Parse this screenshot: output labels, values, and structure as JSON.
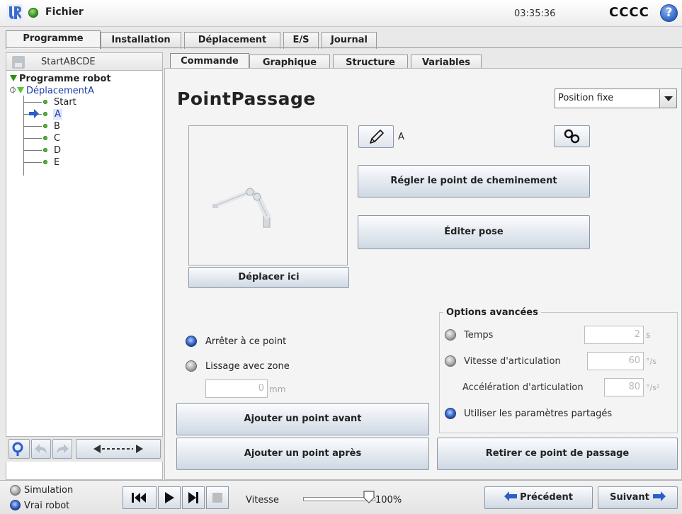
{
  "topbar": {
    "file_label": "Fichier",
    "clock": "03:35:36",
    "robot_name": "CCCC",
    "help_label": "?"
  },
  "main_tabs": [
    {
      "label": "Programme",
      "active": true
    },
    {
      "label": "Installation",
      "active": false
    },
    {
      "label": "Déplacement",
      "active": false
    },
    {
      "label": "E/S",
      "active": false
    },
    {
      "label": "Journal",
      "active": false
    }
  ],
  "left_panel": {
    "program_name": "StartABCDE",
    "tree": {
      "root": "Programme robot",
      "move": "DéplacementA",
      "waypoints": [
        "Start",
        "A",
        "B",
        "C",
        "D",
        "E"
      ],
      "selected": "A"
    }
  },
  "sub_tabs": [
    {
      "label": "Commande",
      "active": true
    },
    {
      "label": "Graphique",
      "active": false
    },
    {
      "label": "Structure",
      "active": false
    },
    {
      "label": "Variables",
      "active": false
    }
  ],
  "waypoint": {
    "title": "PointPassage",
    "type_dropdown": "Position fixe",
    "name": "A",
    "set_waypoint_button": "Régler le point de cheminement",
    "edit_pose_button": "Éditer pose",
    "move_here_button": "Déplacer ici",
    "stop_at_point": "Arrêter à ce point",
    "blend_with_radius": "Lissage avec zone",
    "blend_value": "0",
    "blend_unit": "mm",
    "add_before_button": "Ajouter un point avant",
    "add_after_button": "Ajouter un point après",
    "remove_button": "Retirer ce point de passage"
  },
  "advanced": {
    "title": "Options avancées",
    "time_label": "Temps",
    "time_value": "2",
    "time_unit": "s",
    "joint_speed_label": "Vitesse d'articulation",
    "joint_speed_value": "60",
    "joint_speed_unit": "°/s",
    "joint_accel_label": "Accélération d'articulation",
    "joint_accel_value": "80",
    "joint_accel_unit": "°/s²",
    "shared_params_label": "Utiliser les paramètres partagés"
  },
  "bottombar": {
    "simulation_label": "Simulation",
    "real_robot_label": "Vrai robot",
    "speed_label": "Vitesse",
    "speed_value": "100%",
    "previous_button": "Précédent",
    "next_button": "Suivant"
  },
  "colors": {
    "accent_blue": "#2d62c4",
    "tree_green": "#52b634",
    "selected_text": "#1a3ea8"
  }
}
